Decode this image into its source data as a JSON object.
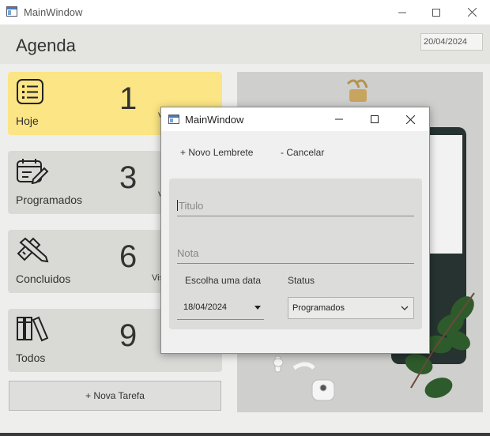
{
  "window": {
    "title": "MainWindow"
  },
  "header": {
    "title": "Agenda",
    "date": "20/04/2024"
  },
  "cards": [
    {
      "label": "Hoje",
      "count": "1",
      "side": "V",
      "color": "#fbe584",
      "icon": "list-icon"
    },
    {
      "label": "Programados",
      "count": "3",
      "side": "V",
      "color": "#d9d9d6",
      "icon": "calendar-edit-icon"
    },
    {
      "label": "Concluidos",
      "count": "6",
      "side": "Vis",
      "color": "#d9d9d6",
      "icon": "ruler-pencil-icon"
    },
    {
      "label": "Todos",
      "count": "9",
      "side": "",
      "color": "#d9d9d6",
      "icon": "books-icon"
    }
  ],
  "new_task_label": "+ Nova Tarefa",
  "dialog": {
    "title": "MainWindow",
    "new_reminder_label": "+ Novo Lembrete",
    "cancel_label": "- Cancelar",
    "title_placeholder": "Titulo",
    "note_placeholder": "Nota",
    "date_label": "Escolha uma data",
    "date_value": "18/04/2024",
    "status_label": "Status",
    "status_value": "Programados"
  }
}
